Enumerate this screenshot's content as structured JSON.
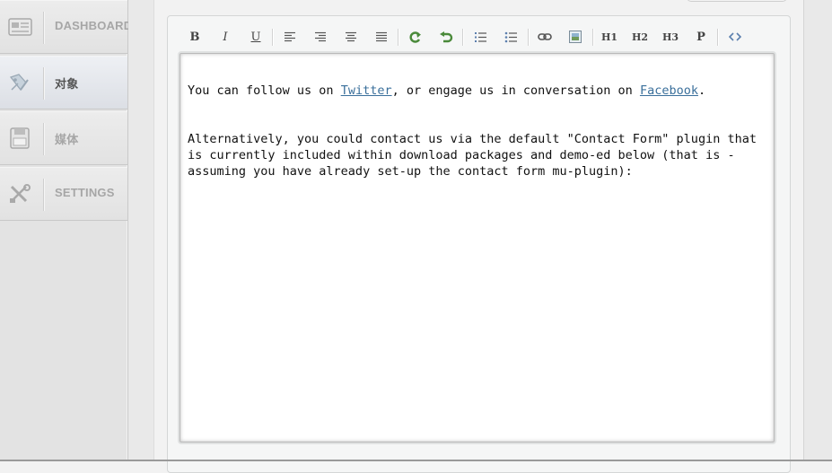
{
  "sidebar": {
    "items": [
      {
        "id": "dashboard",
        "label": "DASHBOARD",
        "icon": "dashboard-icon",
        "active": false
      },
      {
        "id": "objects",
        "label": "对象",
        "icon": "objects-icon",
        "active": true
      },
      {
        "id": "media",
        "label": "媒体",
        "icon": "media-icon",
        "active": false
      },
      {
        "id": "settings",
        "label": "SETTINGS",
        "icon": "settings-icon",
        "active": false
      }
    ]
  },
  "toolbar": {
    "buttons": [
      {
        "id": "bold",
        "glyph": "B",
        "icon": "bold-icon"
      },
      {
        "id": "italic",
        "glyph": "I",
        "icon": "italic-icon"
      },
      {
        "id": "underline",
        "glyph": "U",
        "icon": "underline-icon"
      },
      {
        "id": "align-left",
        "icon": "align-left-icon"
      },
      {
        "id": "align-right",
        "icon": "align-right-icon"
      },
      {
        "id": "align-center",
        "icon": "align-center-icon"
      },
      {
        "id": "justify",
        "icon": "justify-icon"
      },
      {
        "id": "redo",
        "icon": "redo-icon"
      },
      {
        "id": "undo",
        "icon": "undo-icon"
      },
      {
        "id": "ordered-list",
        "icon": "ordered-list-icon"
      },
      {
        "id": "unordered-list",
        "icon": "unordered-list-icon"
      },
      {
        "id": "link",
        "icon": "link-icon"
      },
      {
        "id": "image",
        "icon": "image-icon"
      },
      {
        "id": "h1",
        "glyph": "H1",
        "icon": "heading1-icon"
      },
      {
        "id": "h2",
        "glyph": "H2",
        "icon": "heading2-icon"
      },
      {
        "id": "h3",
        "glyph": "H3",
        "icon": "heading3-icon"
      },
      {
        "id": "paragraph",
        "glyph": "P",
        "icon": "paragraph-icon"
      },
      {
        "id": "source",
        "icon": "code-view-icon"
      }
    ]
  },
  "editor": {
    "para1": {
      "before": "You can follow us on ",
      "link1": "Twitter",
      "middle": ", or engage us in conversation on ",
      "link2": "Facebook",
      "after": "."
    },
    "para2": "Alternatively, you could contact us via the default \"Contact Form\" plugin that is currently included within download packages and demo-ed below (that is - assuming you have already set-up the contact form mu-plugin):"
  },
  "colors": {
    "link": "#3a6f9b",
    "icon_green": "#4a8a3a",
    "icon_blue": "#5b7fae"
  }
}
